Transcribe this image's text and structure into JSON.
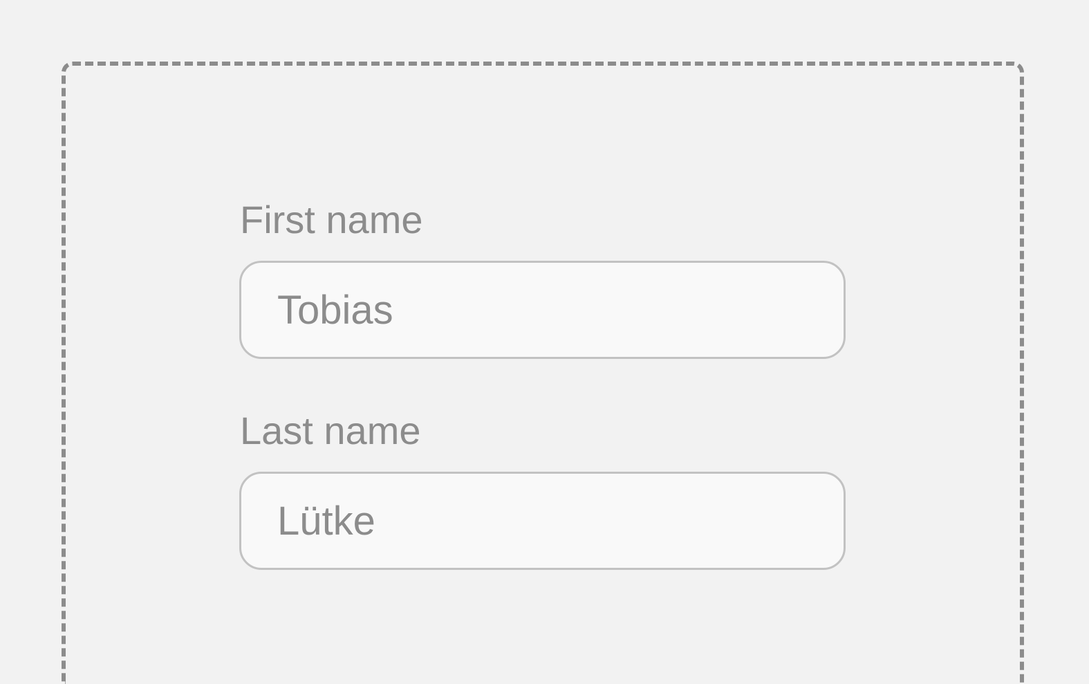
{
  "form": {
    "first_name": {
      "label": "First name",
      "value": "Tobias"
    },
    "last_name": {
      "label": "Last name",
      "value": "Lütke"
    }
  },
  "colors": {
    "background": "#f2f2f2",
    "frame_dash": "#8c8c8c",
    "text": "#8c8c8c",
    "input_border": "#c2c2c2",
    "input_background": "#f9f9f9"
  }
}
